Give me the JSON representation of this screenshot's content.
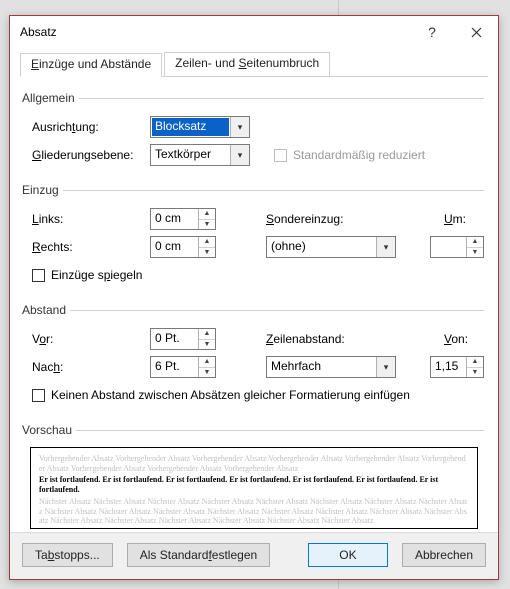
{
  "title": "Absatz",
  "tabs": {
    "indent": {
      "pre": "E",
      "post": "inzüge und Abstände"
    },
    "breaks": {
      "pre1": "Zeilen- und ",
      "u": "S",
      "post": "eitenumbruch"
    }
  },
  "group_general": "Allgemein",
  "alignment": {
    "label_pre": "Ausrich",
    "label_u": "t",
    "label_post": "ung:",
    "value": "Blocksatz"
  },
  "outline": {
    "label_pre": "",
    "label_u": "G",
    "label_post": "liederungsebene:",
    "value": "Textkörper"
  },
  "reduced": {
    "label": "Standardmäßig reduziert"
  },
  "group_indent": "Einzug",
  "left": {
    "label_u": "L",
    "label_post": "inks:",
    "value": "0 cm"
  },
  "right": {
    "label_u": "R",
    "label_post": "echts:",
    "value": "0 cm"
  },
  "special": {
    "label_pre": "",
    "label_u": "S",
    "label_post": "ondereinzug:",
    "value": "(ohne)"
  },
  "by": {
    "label_u": "U",
    "label_post": "m:",
    "value": ""
  },
  "mirror": {
    "label_pre": "Einzüge s",
    "label_u": "p",
    "label_post": "iegeln"
  },
  "group_spacing": "Abstand",
  "before": {
    "label_pre": "V",
    "label_u": "o",
    "label_post": "r:",
    "value": "0 Pt."
  },
  "after": {
    "label_pre": "Nac",
    "label_u": "h",
    "label_post": ":",
    "value": "6 Pt."
  },
  "linespacing": {
    "label_u": "Z",
    "label_post": "eilenabstand:",
    "value": "Mehrfach"
  },
  "at": {
    "label_pre": "",
    "label_u": "V",
    "label_post": "on:",
    "value": "1,15"
  },
  "nospacing": {
    "label": "Keinen Abstand zwischen Absätzen gleicher Formatierung einfügen"
  },
  "group_preview": "Vorschau",
  "preview": {
    "gray1": "Vorhergehender Absatz Vorhergehender Absatz Vorhergehender Absatz Vorhergehender Absatz Vorhergehender Absatz Vorhergehender Absatz Vorhergehender Absatz Vorhergehender Absatz Vorhergehender Absatz",
    "black": "Er ist fortlaufend. Er ist fortlaufend. Er ist fortlaufend. Er ist fortlaufend. Er ist fortlaufend. Er ist fortlaufend. Er ist fortlaufend.",
    "gray2": "Nächster Absatz Nächster Absatz Nächster Absatz Nächster Absatz Nächster Absatz Nächster Absatz Nächster Absatz Nächster Absatz Nächster Absatz Nächster Absatz Nächster Absatz Nächster Absatz Nächster Absatz Nächster Absatz Nächster Absatz Nächster Absatz Nächster Absatz Nächster Absatz Nächster Absatz Nächster Absatz Nächster Absatz Nächster Absatz"
  },
  "buttons": {
    "tabs": {
      "pre": "Ta",
      "u": "b",
      "post": "stopps..."
    },
    "default": {
      "pre": "Als Standard ",
      "u": "f",
      "post": "estlegen"
    },
    "ok": "OK",
    "cancel": "Abbrechen"
  }
}
